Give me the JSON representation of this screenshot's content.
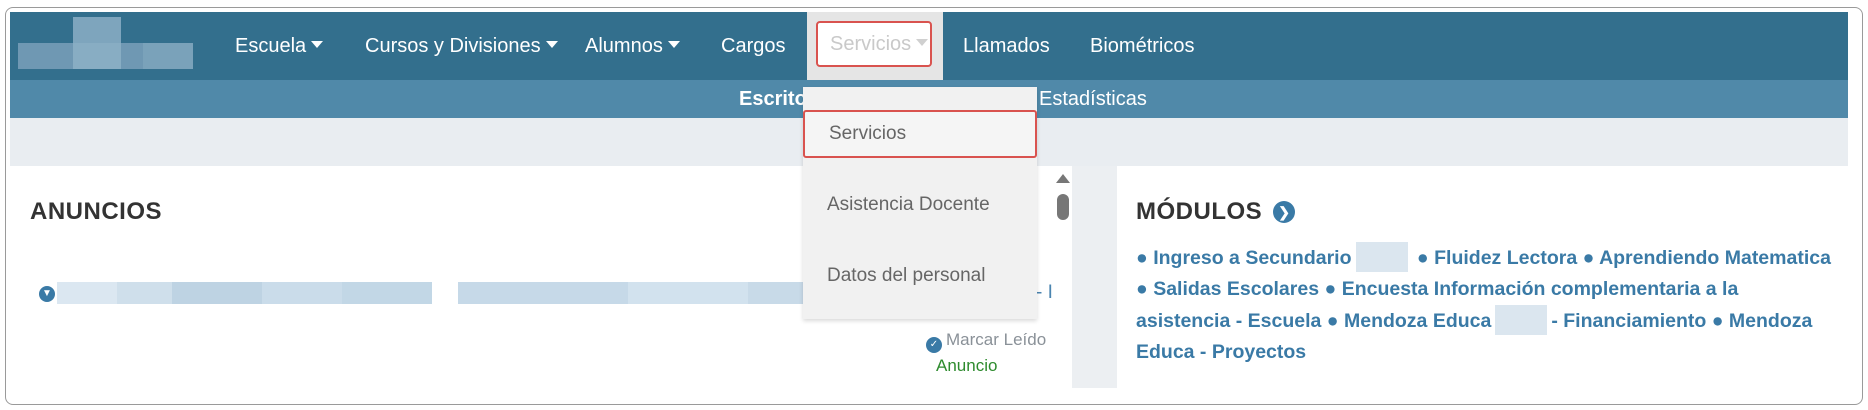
{
  "nav": {
    "items": [
      {
        "label": "Escuela",
        "caret": true
      },
      {
        "label": "Cursos y Divisiones",
        "caret": true
      },
      {
        "label": "Alumnos",
        "caret": true
      },
      {
        "label": "Cargos",
        "caret": false
      },
      {
        "label": "Servicios",
        "caret": true,
        "active": true
      },
      {
        "label": "Llamados",
        "caret": false
      },
      {
        "label": "Biométricos",
        "caret": false
      }
    ]
  },
  "subnav": {
    "left_label": "Escrito",
    "right_label": "Estadísticas"
  },
  "dropdown": {
    "items": [
      "Servicios",
      "Asistencia Docente",
      "Datos del personal"
    ]
  },
  "anuncios": {
    "title": "ANUNCIOS",
    "mark_read_label": "Marcar Leído",
    "type_label": "Anuncio",
    "trailing": "- I"
  },
  "modulos": {
    "title": "MÓDULOS",
    "links": [
      "Ingreso a Secundario",
      "Fluidez Lectora",
      "Aprendiendo Matematica",
      "Salidas Escolares",
      "Encuesta Información complementaria a la asistencia - Escuela",
      "Mendoza Educa",
      "- Financiamiento",
      "Mendoza Educa - Proyectos"
    ]
  },
  "colors": {
    "nav_bg": "#336f8d",
    "subnav_bg": "#5089a9",
    "link": "#3a7aa6",
    "highlight_border": "#d9534f",
    "anuncio_green": "#2e8b2e"
  }
}
